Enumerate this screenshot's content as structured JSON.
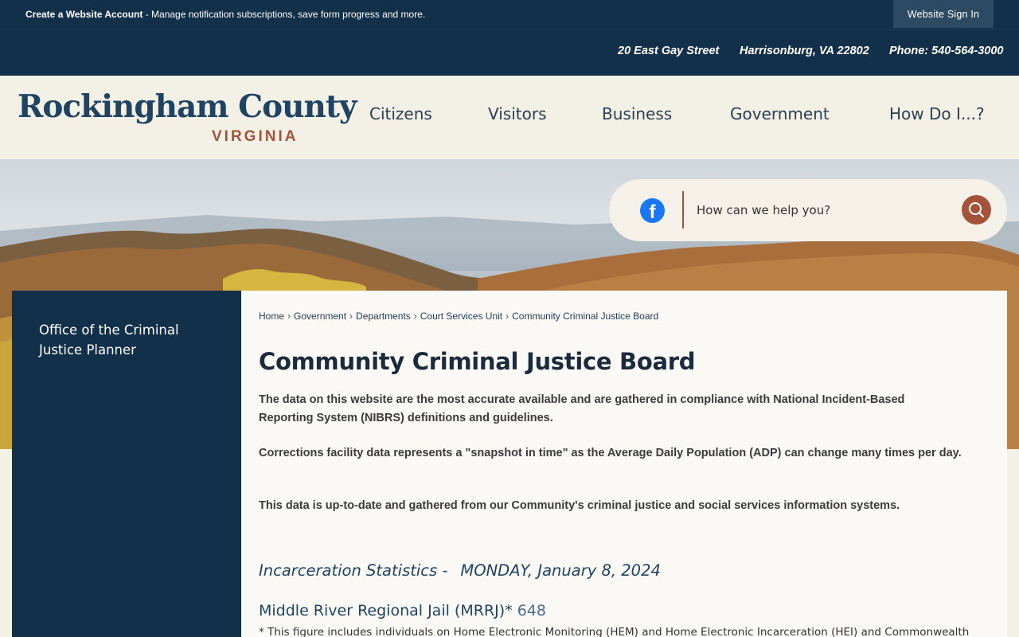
{
  "topbar": {
    "create_account_bold": "Create a Website Account",
    "create_account_text": " - Manage notification subscriptions, save form progress and more.",
    "sign_in": "Website Sign In"
  },
  "contact": {
    "street": "20 East Gay Street",
    "city": "Harrisonburg, VA 22802",
    "phone": "Phone: 540-564-3000"
  },
  "logo": {
    "title": "Rockingham County",
    "subtitle": "VIRGINIA"
  },
  "nav": [
    "Citizens",
    "Visitors",
    "Business",
    "Government",
    "How Do I...?"
  ],
  "search": {
    "placeholder": "How can we help you?",
    "facebook_icon": "facebook-icon",
    "search_icon": "magnifier-icon"
  },
  "sidebar": {
    "items": [
      {
        "label": "Office of the Criminal Justice Planner"
      }
    ]
  },
  "breadcrumb": [
    "Home",
    "Government",
    "Departments",
    "Court Services Unit",
    "Community Criminal Justice Board"
  ],
  "page": {
    "title": "Community Criminal Justice Board",
    "paragraphs": [
      "The data on this website are the most accurate available and are gathered in compliance with National Incident-Based Reporting System (NIBRS) definitions and guidelines.",
      "Corrections facility data represents a \"snapshot in time\" as the Average Daily Population (ADP) can change many times per day.",
      "This data is up-to-date and gathered from our Community's criminal justice and social services information systems."
    ],
    "stats_label": "Incarceration Statistics -",
    "stats_date": "MONDAY, January 8, 2024",
    "facility_name": "Middle River Regional Jail (MRRJ)*",
    "facility_count": "648",
    "footnote": "* This figure includes individuals on Home Electronic Monitoring (HEM) and Home Electronic Incarceration (HEI) and Commonwealth"
  },
  "colors": {
    "navy": "#12304a",
    "rust": "#a4533a",
    "cream": "#f3f0e6"
  }
}
